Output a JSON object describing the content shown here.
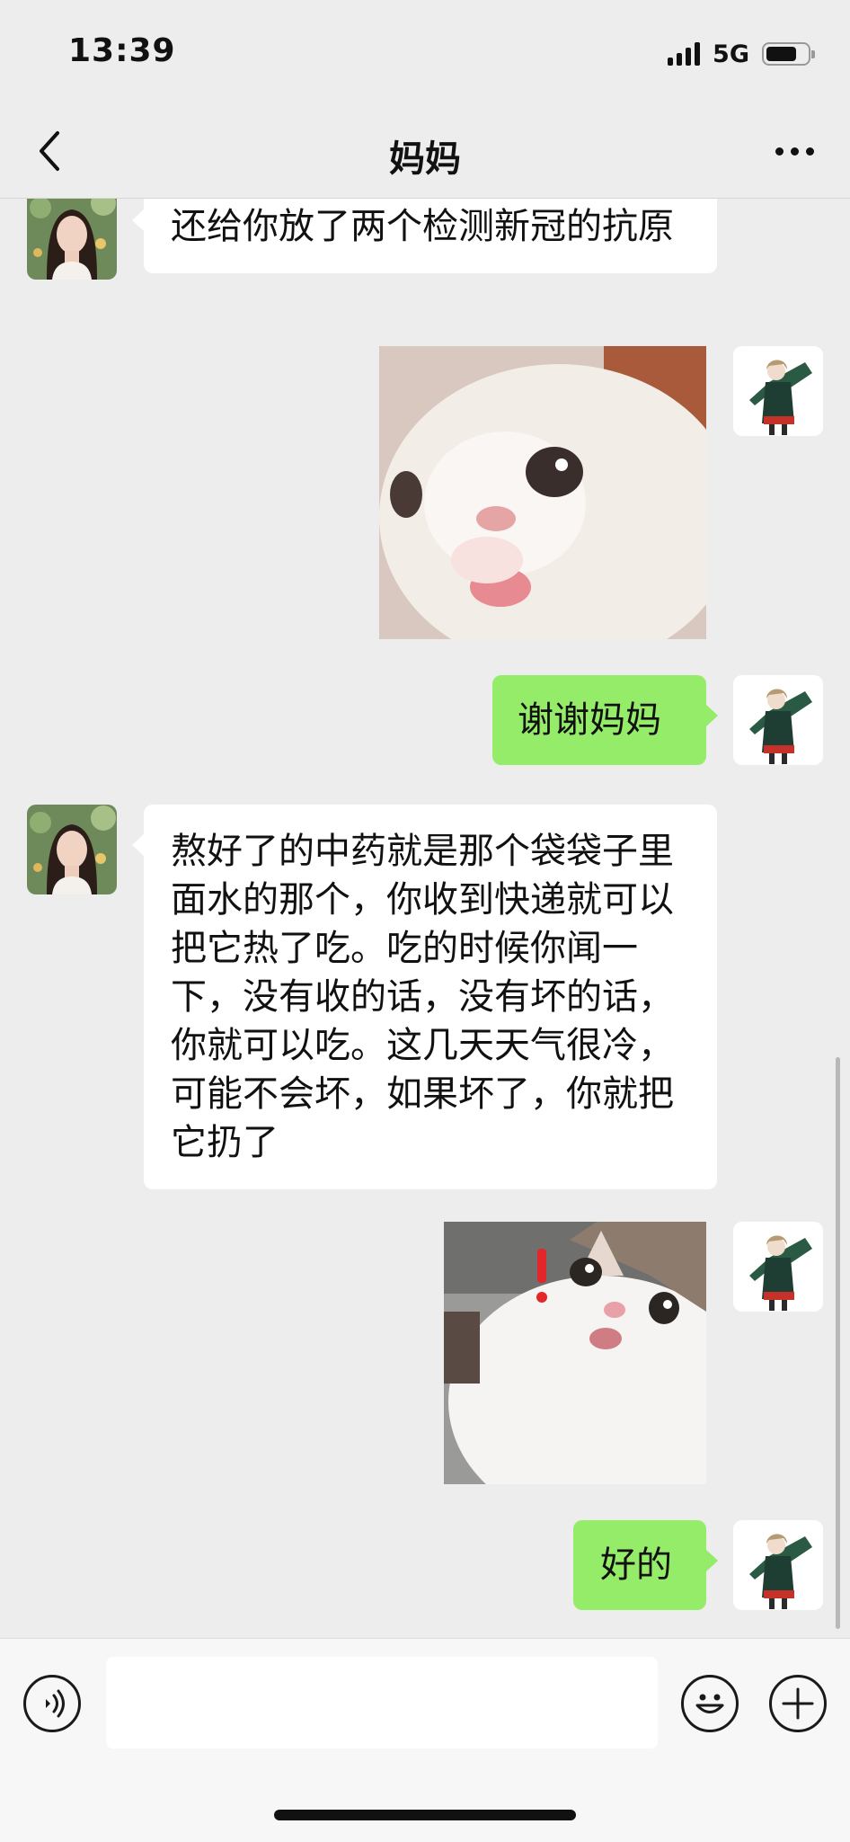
{
  "status": {
    "time": "13:39",
    "network": "5G",
    "battery_level": 0.75
  },
  "header": {
    "title": "妈妈"
  },
  "messages": [
    {
      "side": "left",
      "type": "text",
      "text": "还给你放了两个检测新冠的抗原"
    },
    {
      "side": "right",
      "type": "sticker",
      "sticker": "white-cat-tongue-sticker"
    },
    {
      "side": "right",
      "type": "text",
      "text": "谢谢妈妈"
    },
    {
      "side": "left",
      "type": "text",
      "text": "熬好了的中药就是那个袋袋子里面水的那个，你收到快递就可以把它热了吃。吃的时候你闻一下，没有收的话，没有坏的话，你就可以吃。这几天天气很冷，可能不会坏，如果坏了，你就把它扔了"
    },
    {
      "side": "right",
      "type": "sticker",
      "sticker": "surprised-cat-sticker"
    },
    {
      "side": "right",
      "type": "text",
      "text": "好的"
    }
  ],
  "input": {
    "value": "",
    "placeholder": ""
  },
  "colors": {
    "background": "#ededed",
    "outgoing_bubble": "#95ec69",
    "incoming_bubble": "#ffffff"
  },
  "icons": [
    "back-icon",
    "more-icon",
    "voice-icon",
    "emoji-icon",
    "plus-icon"
  ]
}
